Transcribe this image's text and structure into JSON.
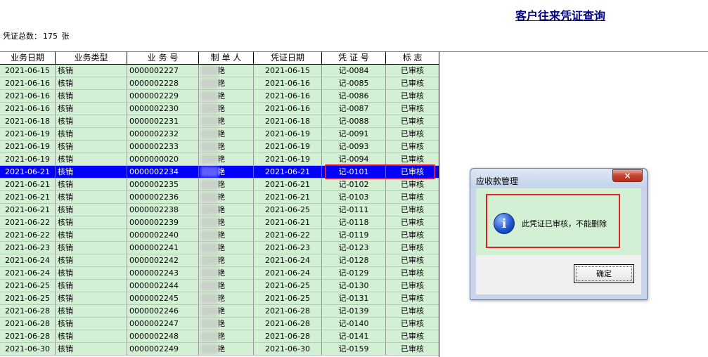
{
  "page": {
    "title": "客户往来凭证查询",
    "summary_label": "凭证总数：",
    "summary_count": "175",
    "summary_unit": "张"
  },
  "grid": {
    "columns": [
      "业务日期",
      "业务类型",
      "业 务 号",
      "制 单 人",
      "凭证日期",
      "凭 证 号",
      "标    志"
    ],
    "selected_index": 8,
    "rows": [
      {
        "date": "2021-06-15",
        "type": "核销",
        "no": "0000002227",
        "maker": "艳",
        "vdate": "2021-06-15",
        "vno": "记-0084",
        "flag": "已审核"
      },
      {
        "date": "2021-06-16",
        "type": "核销",
        "no": "0000002228",
        "maker": "艳",
        "vdate": "2021-06-16",
        "vno": "记-0085",
        "flag": "已审核"
      },
      {
        "date": "2021-06-16",
        "type": "核销",
        "no": "0000002229",
        "maker": "艳",
        "vdate": "2021-06-16",
        "vno": "记-0086",
        "flag": "已审核"
      },
      {
        "date": "2021-06-16",
        "type": "核销",
        "no": "0000002230",
        "maker": "艳",
        "vdate": "2021-06-16",
        "vno": "记-0087",
        "flag": "已审核"
      },
      {
        "date": "2021-06-18",
        "type": "核销",
        "no": "0000002231",
        "maker": "艳",
        "vdate": "2021-06-18",
        "vno": "记-0088",
        "flag": "已审核"
      },
      {
        "date": "2021-06-19",
        "type": "核销",
        "no": "0000002232",
        "maker": "艳",
        "vdate": "2021-06-19",
        "vno": "记-0091",
        "flag": "已审核"
      },
      {
        "date": "2021-06-19",
        "type": "核销",
        "no": "0000002233",
        "maker": "艳",
        "vdate": "2021-06-19",
        "vno": "记-0093",
        "flag": "已审核"
      },
      {
        "date": "2021-06-19",
        "type": "核销",
        "no": "0000000020",
        "maker": "艳",
        "vdate": "2021-06-19",
        "vno": "记-0094",
        "flag": "已审核"
      },
      {
        "date": "2021-06-21",
        "type": "核销",
        "no": "0000002234",
        "maker": "艳",
        "vdate": "2021-06-21",
        "vno": "记-0101",
        "flag": "已审核"
      },
      {
        "date": "2021-06-21",
        "type": "核销",
        "no": "0000002235",
        "maker": "艳",
        "vdate": "2021-06-21",
        "vno": "记-0102",
        "flag": "已审核"
      },
      {
        "date": "2021-06-21",
        "type": "核销",
        "no": "0000002236",
        "maker": "艳",
        "vdate": "2021-06-21",
        "vno": "记-0103",
        "flag": "已审核"
      },
      {
        "date": "2021-06-21",
        "type": "核销",
        "no": "0000002238",
        "maker": "艳",
        "vdate": "2021-06-25",
        "vno": "记-0111",
        "flag": "已审核"
      },
      {
        "date": "2021-06-22",
        "type": "核销",
        "no": "0000002239",
        "maker": "艳",
        "vdate": "2021-06-21",
        "vno": "记-0118",
        "flag": "已审核"
      },
      {
        "date": "2021-06-22",
        "type": "核销",
        "no": "0000002240",
        "maker": "艳",
        "vdate": "2021-06-22",
        "vno": "记-0119",
        "flag": "已审核"
      },
      {
        "date": "2021-06-23",
        "type": "核销",
        "no": "0000002241",
        "maker": "艳",
        "vdate": "2021-06-23",
        "vno": "记-0123",
        "flag": "已审核"
      },
      {
        "date": "2021-06-24",
        "type": "核销",
        "no": "0000002242",
        "maker": "艳",
        "vdate": "2021-06-24",
        "vno": "记-0128",
        "flag": "已审核"
      },
      {
        "date": "2021-06-24",
        "type": "核销",
        "no": "0000002243",
        "maker": "艳",
        "vdate": "2021-06-24",
        "vno": "记-0129",
        "flag": "已审核"
      },
      {
        "date": "2021-06-25",
        "type": "核销",
        "no": "0000002244",
        "maker": "艳",
        "vdate": "2021-06-25",
        "vno": "记-0130",
        "flag": "已审核"
      },
      {
        "date": "2021-06-25",
        "type": "核销",
        "no": "0000002245",
        "maker": "艳",
        "vdate": "2021-06-25",
        "vno": "记-0131",
        "flag": "已审核"
      },
      {
        "date": "2021-06-28",
        "type": "核销",
        "no": "0000002246",
        "maker": "艳",
        "vdate": "2021-06-28",
        "vno": "记-0139",
        "flag": "已审核"
      },
      {
        "date": "2021-06-28",
        "type": "核销",
        "no": "0000002247",
        "maker": "艳",
        "vdate": "2021-06-28",
        "vno": "记-0140",
        "flag": "已审核"
      },
      {
        "date": "2021-06-28",
        "type": "核销",
        "no": "0000002248",
        "maker": "艳",
        "vdate": "2021-06-28",
        "vno": "记-0141",
        "flag": "已审核"
      },
      {
        "date": "2021-06-30",
        "type": "核销",
        "no": "0000002249",
        "maker": "艳",
        "vdate": "2021-06-30",
        "vno": "记-0159",
        "flag": "已审核"
      }
    ]
  },
  "dialog": {
    "title": "应收款管理",
    "close_glyph": "×",
    "icon": "info-icon",
    "icon_glyph": "i",
    "message": "此凭证已审核，不能删除",
    "ok_label": "确定"
  },
  "colors": {
    "row_bg": "#d4f0d4",
    "selected_bg": "#0000ff",
    "highlight": "#e02020",
    "title": "#000080"
  }
}
